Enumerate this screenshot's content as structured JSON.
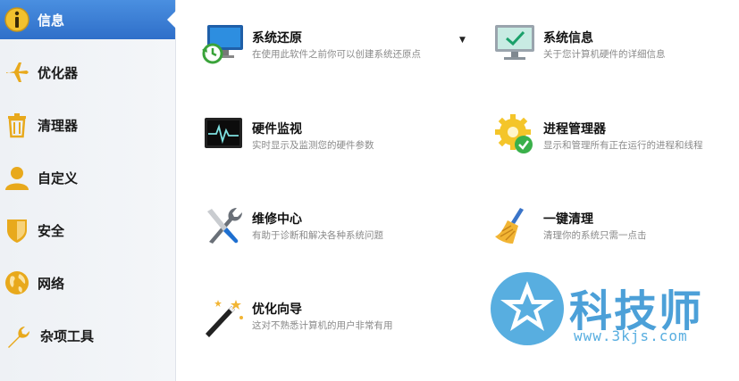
{
  "sidebar": {
    "items": [
      {
        "label": "信息",
        "icon": "info-icon",
        "active": true
      },
      {
        "label": "优化器",
        "icon": "airplane-icon"
      },
      {
        "label": "清理器",
        "icon": "trash-icon"
      },
      {
        "label": "自定义",
        "icon": "user-icon"
      },
      {
        "label": "安全",
        "icon": "shield-icon"
      },
      {
        "label": "网络",
        "icon": "globe-icon"
      },
      {
        "label": "杂项工具",
        "icon": "wrench-icon"
      }
    ]
  },
  "tools": [
    {
      "title": "系统还原",
      "desc": "在使用此软件之前你可以创建系统还原点",
      "icon": "system-restore-icon"
    },
    {
      "title": "系统信息",
      "desc": "关于您计算机硬件的详细信息",
      "icon": "system-info-icon"
    },
    {
      "title": "硬件监视",
      "desc": "实时显示及监测您的硬件参数",
      "icon": "hardware-monitor-icon"
    },
    {
      "title": "进程管理器",
      "desc": "显示和管理所有正在运行的进程和线程",
      "icon": "process-manager-icon"
    },
    {
      "title": "维修中心",
      "desc": "有助于诊断和解决各种系统问题",
      "icon": "repair-center-icon"
    },
    {
      "title": "一键清理",
      "desc": "清理你的系统只需一点击",
      "icon": "one-click-clean-icon"
    },
    {
      "title": "优化向导",
      "desc": "这对不熟悉计算机的用户非常有用",
      "icon": "optimization-wizard-icon"
    }
  ],
  "watermark": {
    "brand": "科技师",
    "url": "www.3kjs.com"
  },
  "colors": {
    "active_nav": "#2f6fc9",
    "icon_gold": "#e8a91c",
    "watermark_blue": "#4ca0d8"
  }
}
